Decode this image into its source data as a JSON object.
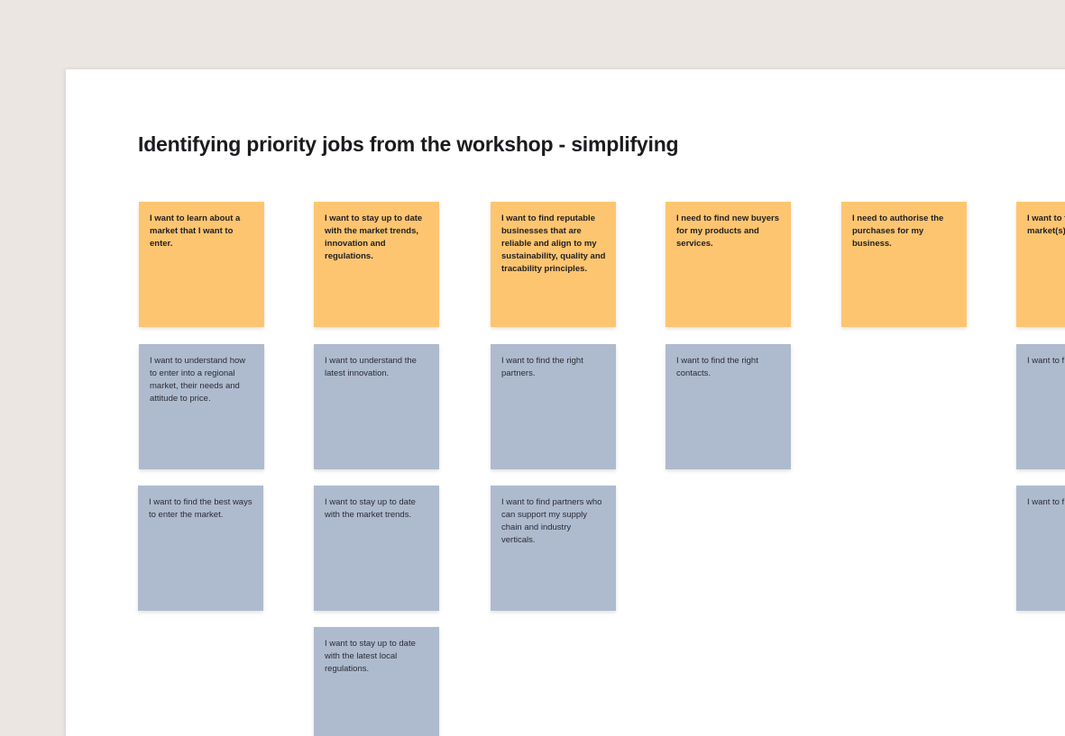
{
  "board": {
    "title": "Identifying priority jobs from the workshop - simplifying"
  },
  "colors": {
    "job_note": "#fdc570",
    "need_note": "#aebbcf",
    "canvas": "#ebe6e1",
    "board": "#ffffff"
  },
  "columns": [
    {
      "job": "I want to learn about a market that I want to enter.",
      "needs": [
        "I want to understand how to enter into a regional market, their needs and attitude to price.",
        "I want to find the best ways to enter the market."
      ]
    },
    {
      "job": "I want to stay up to date with the market trends, innovation and regulations.",
      "needs": [
        "I want to understand the latest innovation.",
        "I want to stay up to date with the market trends.",
        "I want to stay up to date with the latest local regulations."
      ]
    },
    {
      "job": "I want to find reputable businesses that are reliable and align to my sustainability, quality and tracability principles.",
      "needs": [
        "I want to find the right partners.",
        "I want to find partners who can support my supply chain and industry verticals."
      ]
    },
    {
      "job": "I need to find new buyers for my products and services.",
      "needs": [
        "I want to find the right contacts."
      ]
    },
    {
      "job": "I need to authorise the purchases for my business.",
      "needs": []
    },
    {
      "job": "I want to f approved market(s)",
      "needs": [
        "I want to f products a",
        "I want to f without pa"
      ]
    }
  ]
}
